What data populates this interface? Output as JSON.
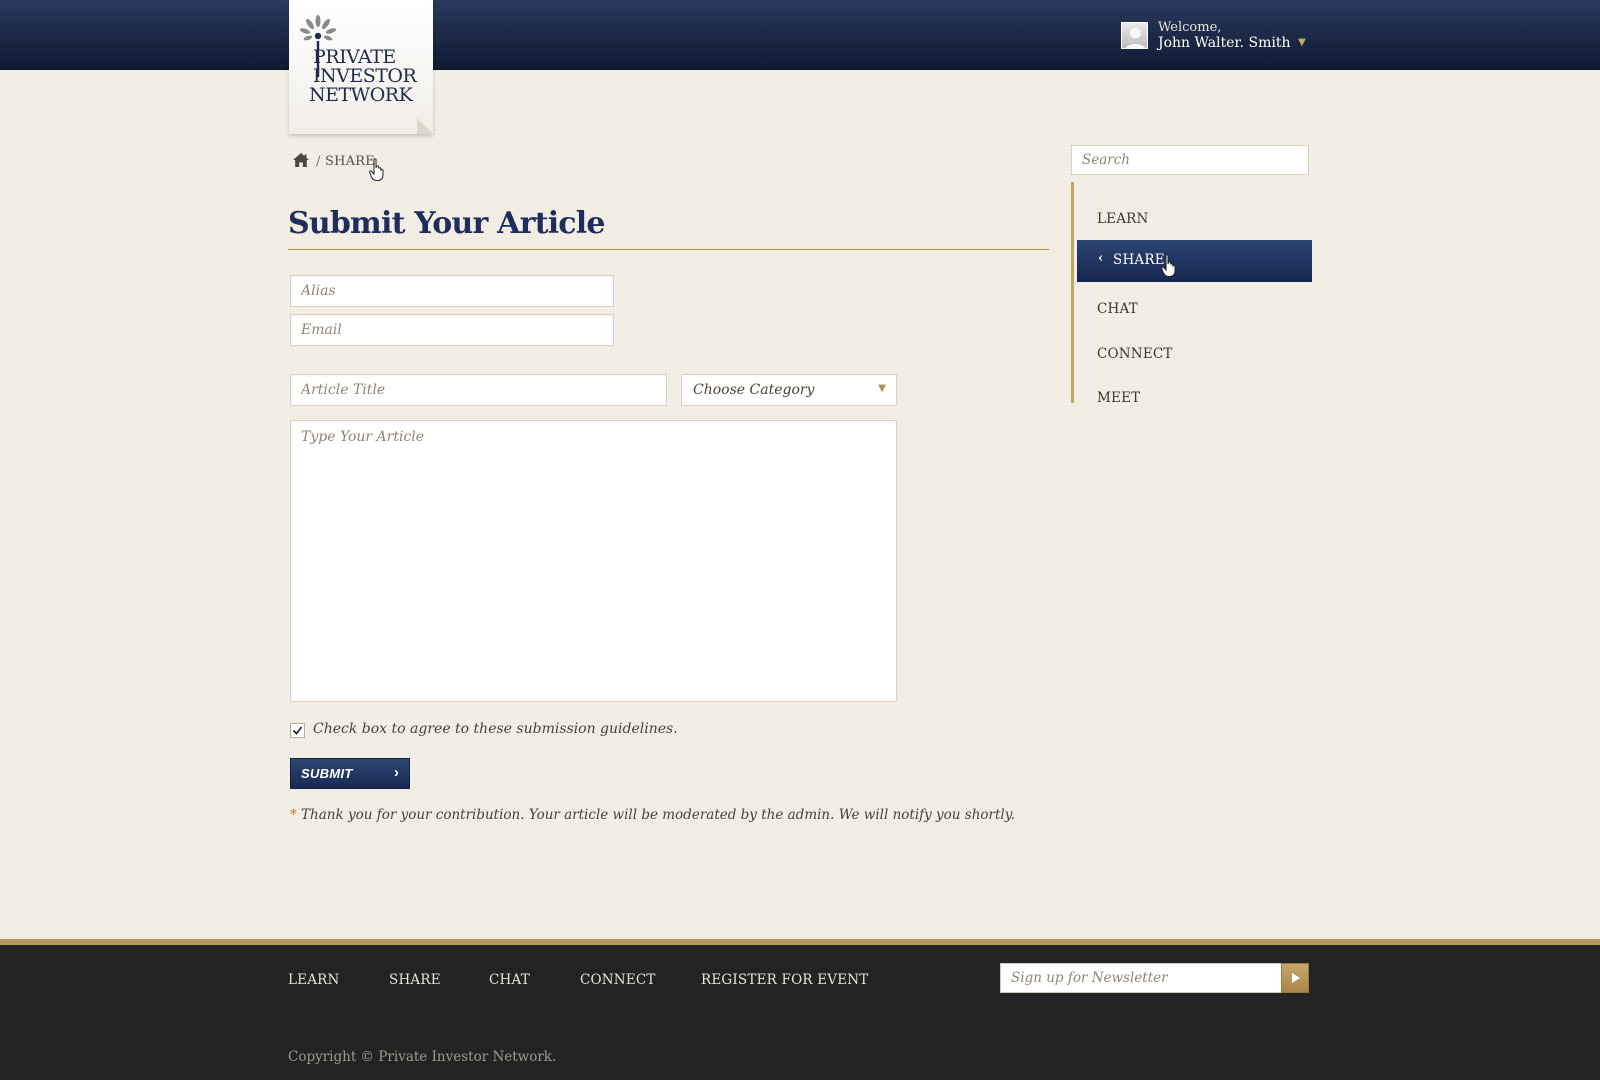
{
  "header": {
    "logo": {
      "line1": "PRIVATE",
      "line2": "INVESTOR",
      "line3": "NETWORK"
    },
    "user": {
      "welcome": "Welcome,",
      "name": "John Walter. Smith"
    }
  },
  "breadcrumb": {
    "separator": "/",
    "current": "SHARE"
  },
  "page": {
    "title": "Submit Your Article"
  },
  "form": {
    "alias_placeholder": "Alias",
    "email_placeholder": "Email",
    "title_placeholder": "Article Title",
    "category_selected": "Choose Category",
    "article_placeholder": "Type Your Article",
    "agree_label": "Check box to agree to these submission guidelines.",
    "agree_checked": true,
    "submit_label": "SUBMIT",
    "notice_asterisk": "*",
    "notice": "Thank you for your contribution. Your article will be moderated  by the admin. We will notify you shortly."
  },
  "sidebar": {
    "search_placeholder": "Search",
    "items": [
      {
        "label": "LEARN",
        "active": false
      },
      {
        "label": "SHARE",
        "active": true
      },
      {
        "label": "CHAT",
        "active": false
      },
      {
        "label": "CONNECT",
        "active": false
      },
      {
        "label": "MEET",
        "active": false
      }
    ]
  },
  "footer": {
    "links": [
      "LEARN",
      "SHARE",
      "CHAT",
      "CONNECT",
      "REGISTER FOR EVENT"
    ],
    "newsletter_placeholder": "Sign up for Newsletter",
    "copyright": "Copyright © Private Investor Network."
  },
  "colors": {
    "navy": "#1f2d5c",
    "gold": "#b8995b",
    "background": "#f3efe6",
    "footer": "#232323",
    "notice_asterisk": "#d46a2a"
  },
  "icons": [
    "home-icon",
    "avatar-icon",
    "caret-down-icon",
    "chevron-left-icon",
    "chevron-right-icon",
    "checkmark-icon",
    "play-arrow-icon",
    "hand-cursor-icon"
  ]
}
